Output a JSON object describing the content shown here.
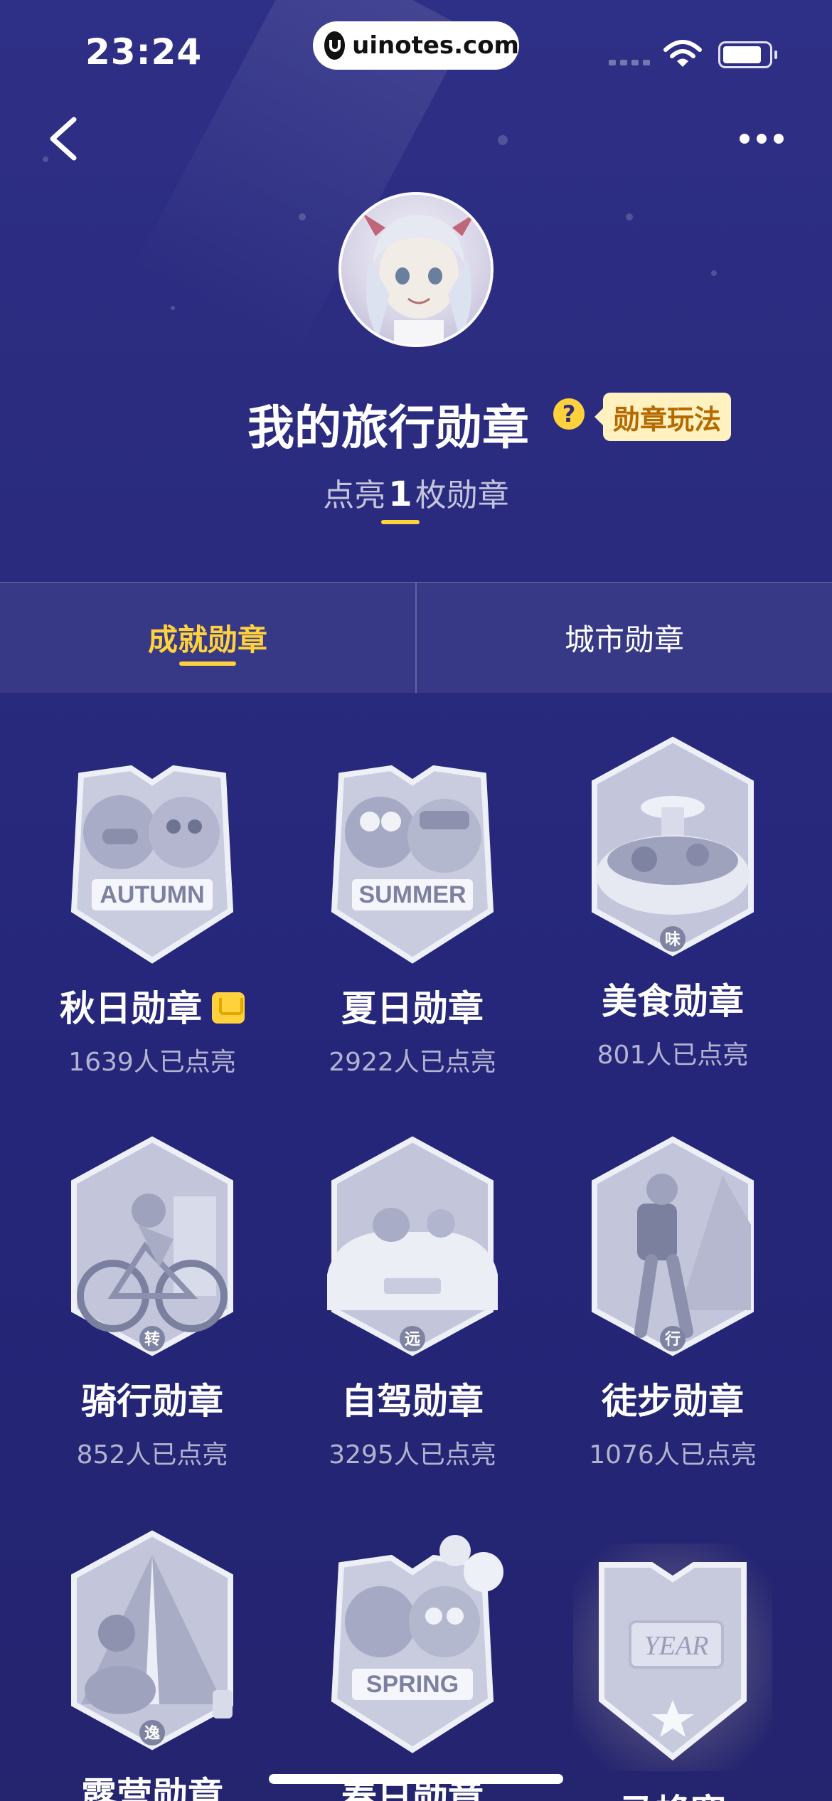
{
  "status_bar": {
    "time": "23:24",
    "watermark": "uinotes.com"
  },
  "header": {
    "title": "我的旅行勋章",
    "rules_label": "勋章玩法",
    "count_prefix": "点亮",
    "count_value": "1",
    "count_suffix": "枚勋章"
  },
  "tabs": [
    {
      "label": "成就勋章",
      "active": true
    },
    {
      "label": "城市勋章",
      "active": false
    }
  ],
  "badges": [
    {
      "name": "秋日勋章",
      "count": "1639人已点亮",
      "banner": "AUTUMN",
      "crowned": true
    },
    {
      "name": "夏日勋章",
      "count": "2922人已点亮",
      "banner": "SUMMER"
    },
    {
      "name": "美食勋章",
      "count": "801人已点亮",
      "seal": "味"
    },
    {
      "name": "骑行勋章",
      "count": "852人已点亮",
      "seal": "转"
    },
    {
      "name": "自驾勋章",
      "count": "3295人已点亮",
      "seal": "远"
    },
    {
      "name": "徒步勋章",
      "count": "1076人已点亮",
      "seal": "行"
    },
    {
      "name": "露营勋章",
      "seal": "逸"
    },
    {
      "name": "春日勋章",
      "banner": "SPRING"
    },
    {
      "name": "马蜂窝",
      "plate": "YEAR"
    }
  ],
  "colors": {
    "accent": "#ffd23d",
    "background": "#2a2b7e"
  }
}
